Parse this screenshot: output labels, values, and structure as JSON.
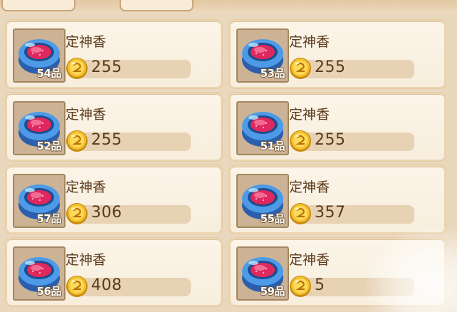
{
  "items": [
    {
      "name": "定神香",
      "grade": "54品",
      "price": "255"
    },
    {
      "name": "定神香",
      "grade": "53品",
      "price": "255"
    },
    {
      "name": "定神香",
      "grade": "52品",
      "price": "255"
    },
    {
      "name": "定神香",
      "grade": "51品",
      "price": "255"
    },
    {
      "name": "定神香",
      "grade": "57品",
      "price": "306"
    },
    {
      "name": "定神香",
      "grade": "55品",
      "price": "357"
    },
    {
      "name": "定神香",
      "grade": "56品",
      "price": "408"
    },
    {
      "name": "定神香",
      "grade": "59品",
      "price": "5"
    }
  ],
  "icons": {
    "item": "incense-burner-icon",
    "currency": "gold-coin-icon"
  },
  "colors": {
    "background": "#ead8be",
    "card": "#fbf4e8",
    "text": "#5a3a1c",
    "coin": "#f2c12e",
    "incense_rim": "#3f86d8",
    "incense_center": "#e0285c"
  }
}
